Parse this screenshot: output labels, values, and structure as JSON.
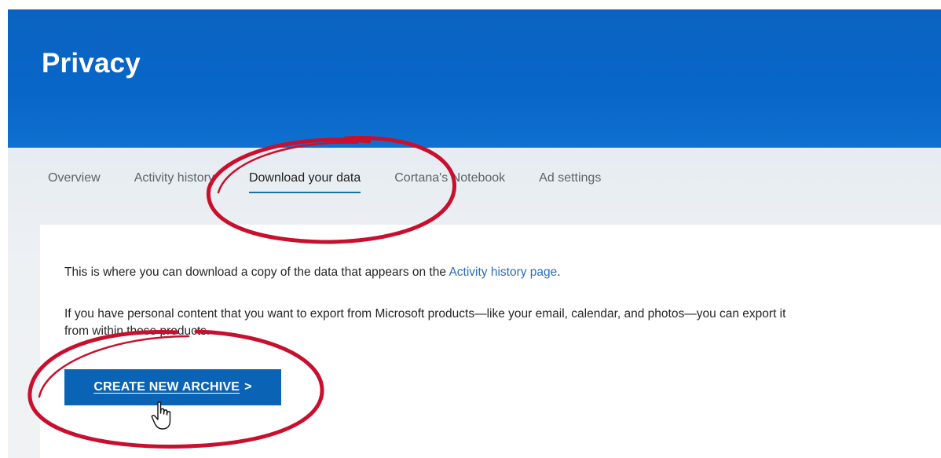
{
  "header": {
    "title": "Privacy"
  },
  "nav": {
    "tabs": [
      {
        "label": "Overview",
        "active": false
      },
      {
        "label": "Activity history",
        "active": false
      },
      {
        "label": "Download your data",
        "active": true
      },
      {
        "label": "Cortana's Notebook",
        "active": false
      },
      {
        "label": "Ad settings",
        "active": false
      }
    ]
  },
  "content": {
    "para1_text": "This is where you can download a copy of the data that appears on the ",
    "para1_link": "Activity history page",
    "para1_end": ".",
    "para2_text": "If you have personal content that you want to export from Microsoft products—like your email, calendar, and photos—you can export it from within those products.",
    "button_label": "CREATE NEW ARCHIVE",
    "button_chevron": ">"
  },
  "colors": {
    "header_blue": "#0866c9",
    "button_blue": "#0b63b6",
    "link_blue": "#2a6ebd",
    "annotation_red": "#c8102e",
    "active_underline": "#1e6f9a"
  },
  "icons": {
    "cursor": "hand-pointer-icon",
    "chevron": "chevron-right-icon"
  }
}
